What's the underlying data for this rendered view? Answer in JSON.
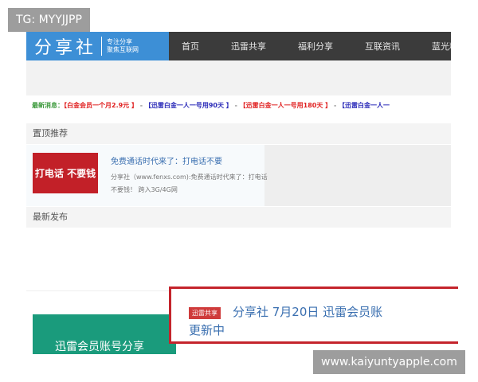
{
  "watermark_top": "TG: MYYJJPP",
  "watermark_bottom": "www.kaiyuntyapple.com",
  "logo": {
    "name": "分享社",
    "slogan1": "专注分享",
    "slogan2": "聚焦互联网"
  },
  "nav": [
    "首页",
    "迅雷共享",
    "福利分享",
    "互联资讯",
    "蓝光精选"
  ],
  "ticker": {
    "label": "最新消息：",
    "items": [
      {
        "text": "【白金会员一个月2.9元 】",
        "color": "#e02020"
      },
      {
        "text": "【迅雷白金一人一号用90天 】",
        "color": "#2a2ab8"
      },
      {
        "text": "【迅雷白金一人一号用180天 】",
        "color": "#e02020"
      },
      {
        "text": "【迅雷白金一人一",
        "color": "#2a2ab8"
      }
    ],
    "sep": " - "
  },
  "pinned": {
    "heading": "置顶推荐",
    "thumb_text": "打电话 不要钱",
    "title": "免费通话时代来了：打电话不要",
    "desc": "分享社（www.fenxs.com):免费通话时代来了：打电话不要钱！ 跨入3G/4G网"
  },
  "latest": {
    "heading": "最新发布",
    "green_text": "迅雷会员账号分享",
    "tag": "迅雷共享",
    "headline1": "分享社 7月20日 迅雷会员账",
    "headline2": "更新中"
  }
}
